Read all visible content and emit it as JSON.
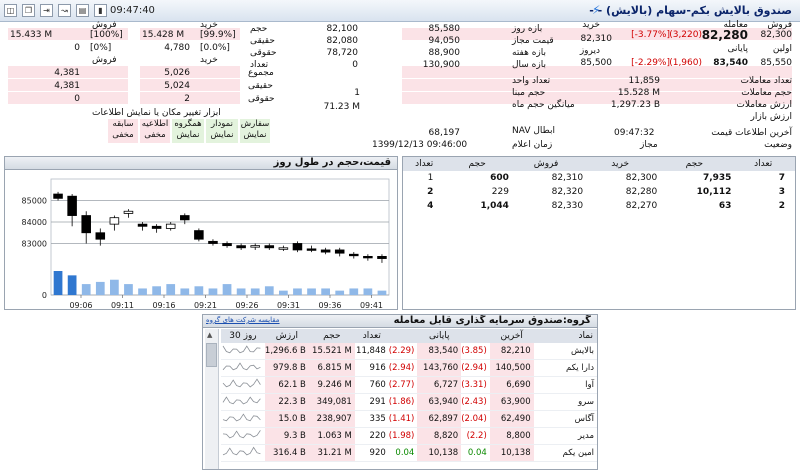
{
  "topbar": {
    "time": "09:47:40",
    "title": "صندوق بالایش بکم-سهام (بالایش) - -"
  },
  "summary": {
    "col1": [
      {
        "label": "فروش",
        "value": "82,300",
        "pink": true
      },
      {
        "label": "معامله",
        "value": "82,280",
        "change": "(3,220)",
        "pct": "[-3.77%]",
        "pink": false
      },
      {
        "label": "پایانی",
        "value": "83,540",
        "change": "(1,960)",
        "pct": "[-2.29%]",
        "extra_label": "اولین",
        "extra_value": "85,550"
      },
      {
        "label": "خرید",
        "value": "82,310"
      },
      {
        "label": "دیروز",
        "value": "85,500"
      }
    ],
    "col2_labels": [
      "بازه روز",
      "قیمت مجاز",
      "بازه هفته",
      "بازه سال"
    ],
    "col2_vals": [
      [
        "82,100",
        "85,580"
      ],
      [
        "82,080",
        "94,050"
      ],
      [
        "78,720",
        "88,900"
      ],
      [
        "0",
        "130,900"
      ]
    ],
    "col2_units": [
      "حجم",
      "حقیقی",
      "حقوقی",
      "تعداد"
    ],
    "buy_sell": {
      "header_buy": "خرید",
      "header_sell": "فروش",
      "rows": [
        {
          "buy_val": "15.428 M",
          "buy_pct": "[99.9%]",
          "sell_val": "15.433 M",
          "sell_pct": "[100%]"
        },
        {
          "buy_val": "4,780",
          "buy_pct": "[0.0%]",
          "sell_val": "0",
          "sell_pct": "[0%]"
        }
      ],
      "sub_header_buy": "خرید",
      "sub_header_sell": "فروش",
      "sub_rows": [
        {
          "label": "مجموع",
          "buy": "5,026",
          "sell": "4,381"
        },
        {
          "label": "حقیقی",
          "buy": "5,024",
          "sell": "4,381"
        },
        {
          "label": "حقوقی",
          "buy": "2",
          "sell": "0"
        }
      ]
    },
    "right_stats": [
      {
        "label": "تعداد معاملات",
        "value": "11,859"
      },
      {
        "label": "حجم معاملات",
        "value": "15.528 M"
      },
      {
        "label": "ارزش معاملات",
        "value": "1,297.23 B"
      },
      {
        "label": "ارزش بازار",
        "value": ""
      }
    ],
    "mid_stats": [
      {
        "label": "تعداد واحد",
        "value": ""
      },
      {
        "label": "حجم مبنا",
        "value": "1"
      },
      {
        "label": "میانگین حجم ماه",
        "value": "71.23 M"
      }
    ],
    "tools_caption": "ابزار تغییر مکان یا نمایش اطلاعات",
    "tools": [
      {
        "top": "سفارش",
        "bottom": "نمایش",
        "style": "g"
      },
      {
        "top": "نمودار",
        "bottom": "نمایش",
        "style": "g"
      },
      {
        "top": "همگروه",
        "bottom": "نمایش",
        "style": "g"
      },
      {
        "top": "اطلاعیه",
        "bottom": "مخفی",
        "style": "p"
      },
      {
        "top": "سابقه",
        "bottom": "مخفی",
        "style": "p"
      }
    ],
    "nav_label": "NAV ابطال",
    "nav_value": "68,197",
    "announce_label": "زمان اعلام",
    "announce_value": "1399/12/13 09:46:00",
    "last_update_label": "آخرین اطلاعات قیمت",
    "last_update_value": "09:47:32",
    "status_label": "وضعیت",
    "status_value": "مجاز"
  },
  "chart": {
    "title": "قیمت،حجم در طول روز",
    "yticks": [
      "85000",
      "84000",
      "83000",
      "0"
    ],
    "xticks": [
      "09:06",
      "09:11",
      "09:16",
      "09:21",
      "09:26",
      "09:31",
      "09:36",
      "09:41"
    ]
  },
  "chart_data": {
    "type": "candlestick",
    "title": "قیمت،حجم در طول روز",
    "x": [
      "09:04",
      "09:05",
      "09:07",
      "09:08",
      "09:10",
      "09:11",
      "09:13",
      "09:15",
      "09:16",
      "09:18",
      "09:20",
      "09:21",
      "09:23",
      "09:25",
      "09:26",
      "09:28",
      "09:30",
      "09:31",
      "09:33",
      "09:35",
      "09:36",
      "09:38",
      "09:40",
      "09:42"
    ],
    "open": [
      85300,
      85200,
      84300,
      83500,
      83900,
      84400,
      83900,
      83800,
      83700,
      84300,
      83600,
      83100,
      83000,
      82900,
      82850,
      82900,
      82750,
      83000,
      82750,
      82700,
      82700,
      82500,
      82400,
      82400
    ],
    "close": [
      85100,
      84300,
      83500,
      83200,
      84200,
      84500,
      83800,
      83700,
      83900,
      84100,
      83200,
      83000,
      82900,
      82800,
      82900,
      82800,
      82800,
      82700,
      82700,
      82600,
      82550,
      82450,
      82350,
      82300
    ],
    "high": [
      85400,
      85300,
      84500,
      83700,
      84300,
      84600,
      84000,
      83900,
      84000,
      84400,
      83700,
      83200,
      83100,
      83000,
      83000,
      83000,
      82900,
      83100,
      82900,
      82800,
      82800,
      82600,
      82500,
      82500
    ],
    "low": [
      85000,
      83800,
      83000,
      82900,
      83600,
      84200,
      83600,
      83500,
      83600,
      83900,
      83100,
      82900,
      82800,
      82700,
      82700,
      82700,
      82650,
      82600,
      82600,
      82500,
      82400,
      82300,
      82200,
      82100
    ],
    "volume_series": [
      {
        "name": "",
        "values": [
          1.1,
          0.9,
          0.5,
          0.6,
          0.7,
          0.5,
          0.3,
          0.4,
          0.5,
          0.3,
          0.4,
          0.3,
          0.5,
          0.3,
          0.3,
          0.4,
          0.2,
          0.3,
          0.3,
          0.3,
          0.2,
          0.3,
          0.3,
          0.2
        ]
      }
    ],
    "yticks": [
      85000,
      84000,
      83000
    ],
    "ylim": [
      82000,
      86000
    ],
    "grid": true
  },
  "orderbook": {
    "headers": [
      "تعداد",
      "حجم",
      "خرید",
      "فروش",
      "حجم",
      "تعداد"
    ],
    "rows": [
      {
        "buy_count": "7",
        "buy_vol": "7,935",
        "buy_price": "82,300",
        "sell_price": "82,310",
        "sell_vol": "600",
        "sell_count": "1"
      },
      {
        "buy_count": "3",
        "buy_vol": "10,112",
        "buy_price": "82,280",
        "sell_price": "82,320",
        "sell_vol": "229",
        "sell_count": "2"
      },
      {
        "buy_count": "2",
        "buy_vol": "63",
        "buy_price": "82,270",
        "sell_price": "82,330",
        "sell_vol": "1,044",
        "sell_count": "4"
      }
    ]
  },
  "group": {
    "title": "گروه:صندوق سرمایه گذاری قابل معامله",
    "compare_link": "مقایسه شرکت های گروه",
    "headers": [
      "نماد",
      "آخرین",
      "",
      "پایانی",
      "",
      "تعداد",
      "حجم",
      "ارزش",
      "30 روز"
    ],
    "rows": [
      {
        "name": "بالایش",
        "last": "82,210",
        "last_ch": "(3.85)",
        "close": "83,540",
        "close_ch": "(2.29)",
        "count": "11,848",
        "vol": "15.521 M",
        "value": "1,296.6 B",
        "lc": "red",
        "cc": "red"
      },
      {
        "name": "دارا یکم",
        "last": "140,500",
        "last_ch": "(2.94)",
        "close": "143,760",
        "close_ch": "(2.94)",
        "count": "916",
        "vol": "6.815 M",
        "value": "979.8 B",
        "lc": "red",
        "cc": "red"
      },
      {
        "name": "آوا",
        "last": "6,690",
        "last_ch": "(3.31)",
        "close": "6,727",
        "close_ch": "(2.77)",
        "count": "760",
        "vol": "9.246 M",
        "value": "62.1 B",
        "lc": "red",
        "cc": "red"
      },
      {
        "name": "سرو",
        "last": "63,900",
        "last_ch": "(2.43)",
        "close": "63,940",
        "close_ch": "(1.86)",
        "count": "291",
        "vol": "349,081",
        "value": "22.3 B",
        "lc": "red",
        "cc": "red"
      },
      {
        "name": "آگاس",
        "last": "62,490",
        "last_ch": "(2.04)",
        "close": "62,897",
        "close_ch": "(1.41)",
        "count": "335",
        "vol": "238,907",
        "value": "15.0 B",
        "lc": "red",
        "cc": "red"
      },
      {
        "name": "مدیر",
        "last": "8,800",
        "last_ch": "(2.2)",
        "close": "8,820",
        "close_ch": "(1.98)",
        "count": "220",
        "vol": "1.063 M",
        "value": "9.3 B",
        "lc": "red",
        "cc": "red"
      },
      {
        "name": "امین یکم",
        "last": "10,138",
        "last_ch": "0.04",
        "close": "10,138",
        "close_ch": "0.04",
        "count": "920",
        "vol": "31.21 M",
        "value": "316.4 B",
        "lc": "green",
        "cc": "green"
      }
    ]
  },
  "colors": {
    "pink": "#fbe3e7",
    "red": "#d10000",
    "green": "#0a8a00",
    "volume_bar": "#4d8fd6",
    "header_bg": "#dde2ea"
  }
}
